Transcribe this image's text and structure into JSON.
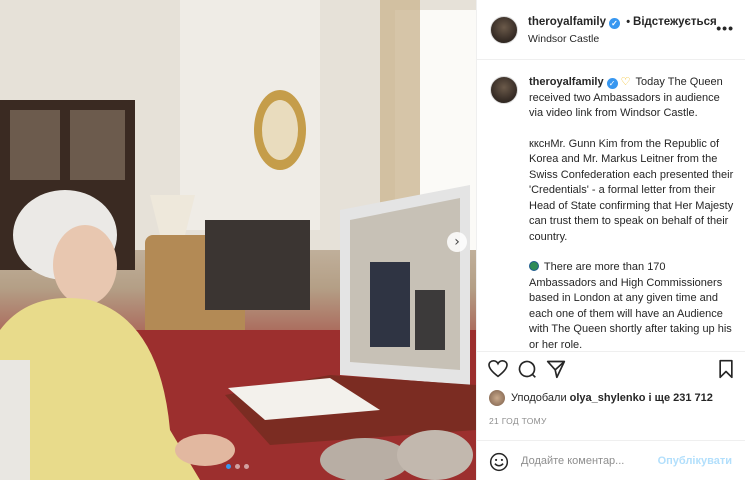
{
  "post": {
    "username": "theroyalfamily",
    "separator": "•",
    "follow_status": "Відстежується",
    "location": "Windsor Castle",
    "more": "•••"
  },
  "caption": {
    "username": "theroyalfamily",
    "line1": "Today The Queen received two Ambassadors in audience via video link from Windsor Castle.",
    "line2": "ккснMr. Gunn Kim from the Republic of Korea and Mr. Markus Leitner from the Swiss Confederation each presented their 'Credentials'  - a formal letter from their Head of State confirming that Her Majesty can trust them to speak on behalf of their country.",
    "line3": "There are more than 170 Ambassadors and High Commissioners based in London at any given time and each one of them will have an Audience with The Queen shortly after taking up his or her role."
  },
  "likes": {
    "prefix": "Уподобали",
    "user": "olya_shylenko",
    "suffix": "і ще 231 712"
  },
  "timestamp": "21 ГОД ТОМУ",
  "comment": {
    "placeholder": "Додайте коментар...",
    "publish": "Опублікувати"
  },
  "carousel": {
    "current": 1,
    "total": 3
  },
  "icons": {
    "verified": "verified-badge-icon",
    "like": "heart-icon",
    "comment": "comment-icon",
    "share": "paper-plane-icon",
    "save": "bookmark-icon",
    "emoji": "smiley-icon",
    "next": "chevron-right-icon"
  },
  "colors": {
    "accent": "#3897f0",
    "publish": "#b2dffc",
    "muted": "#8e8e8e"
  }
}
